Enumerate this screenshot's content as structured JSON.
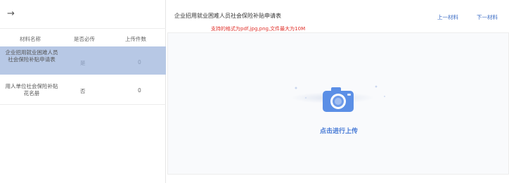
{
  "nav": {
    "back_arrow": "→"
  },
  "table": {
    "headers": [
      "材料名称",
      "是否必传",
      "上传件数"
    ],
    "rows": [
      {
        "name": "企业招用就业困难人员社会保险补贴申请表",
        "required": "是",
        "count": "0"
      },
      {
        "name": "用人单位社会保险补贴花名册",
        "required": "否",
        "count": "0"
      }
    ]
  },
  "main": {
    "title": "企业招用就业困难人员社会保险补贴申请表",
    "prev_label": "上一材料",
    "next_label": "下一材料",
    "hint": "支持的格式为pdf,jpg,png,文件最大为10M",
    "upload_label": "点击进行上传"
  },
  "colors": {
    "selected_row": "#b7c8e5",
    "accent": "#4a7cd6",
    "hint": "#e0302a"
  },
  "icons": {
    "upload": "camera-icon",
    "back": "arrow-right-icon"
  }
}
